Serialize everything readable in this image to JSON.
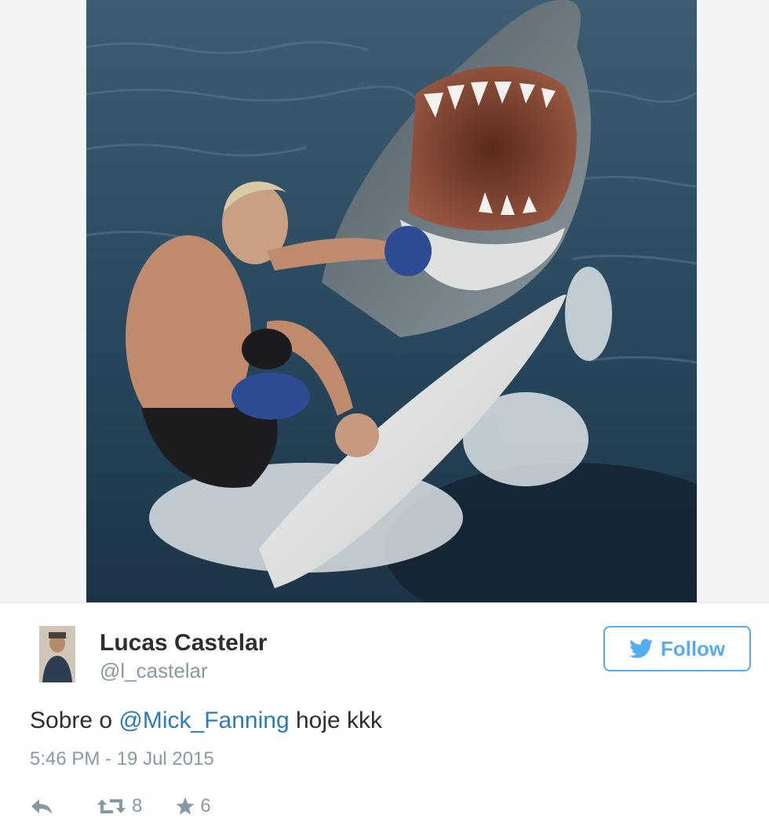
{
  "tweet": {
    "photo": {
      "alt_subject": "shark-surfer-boxing-gloves-photo"
    },
    "user": {
      "display_name": "Lucas Castelar",
      "handle": "@l_castelar"
    },
    "follow_label": "Follow",
    "text_before": "Sobre o ",
    "mention": "@Mick_Fanning",
    "text_after": " hoje kkk",
    "timestamp": "5:46 PM - 19 Jul 2015",
    "actions": {
      "reply_icon": "reply-icon",
      "retweet_icon": "retweet-icon",
      "retweet_count": "8",
      "favorite_icon": "star-icon",
      "favorite_count": "6"
    }
  },
  "colors": {
    "twitter_blue": "#55acee",
    "link_blue": "#2b7bb9",
    "muted_gray": "#8899a6",
    "text_dark": "#292f33"
  }
}
